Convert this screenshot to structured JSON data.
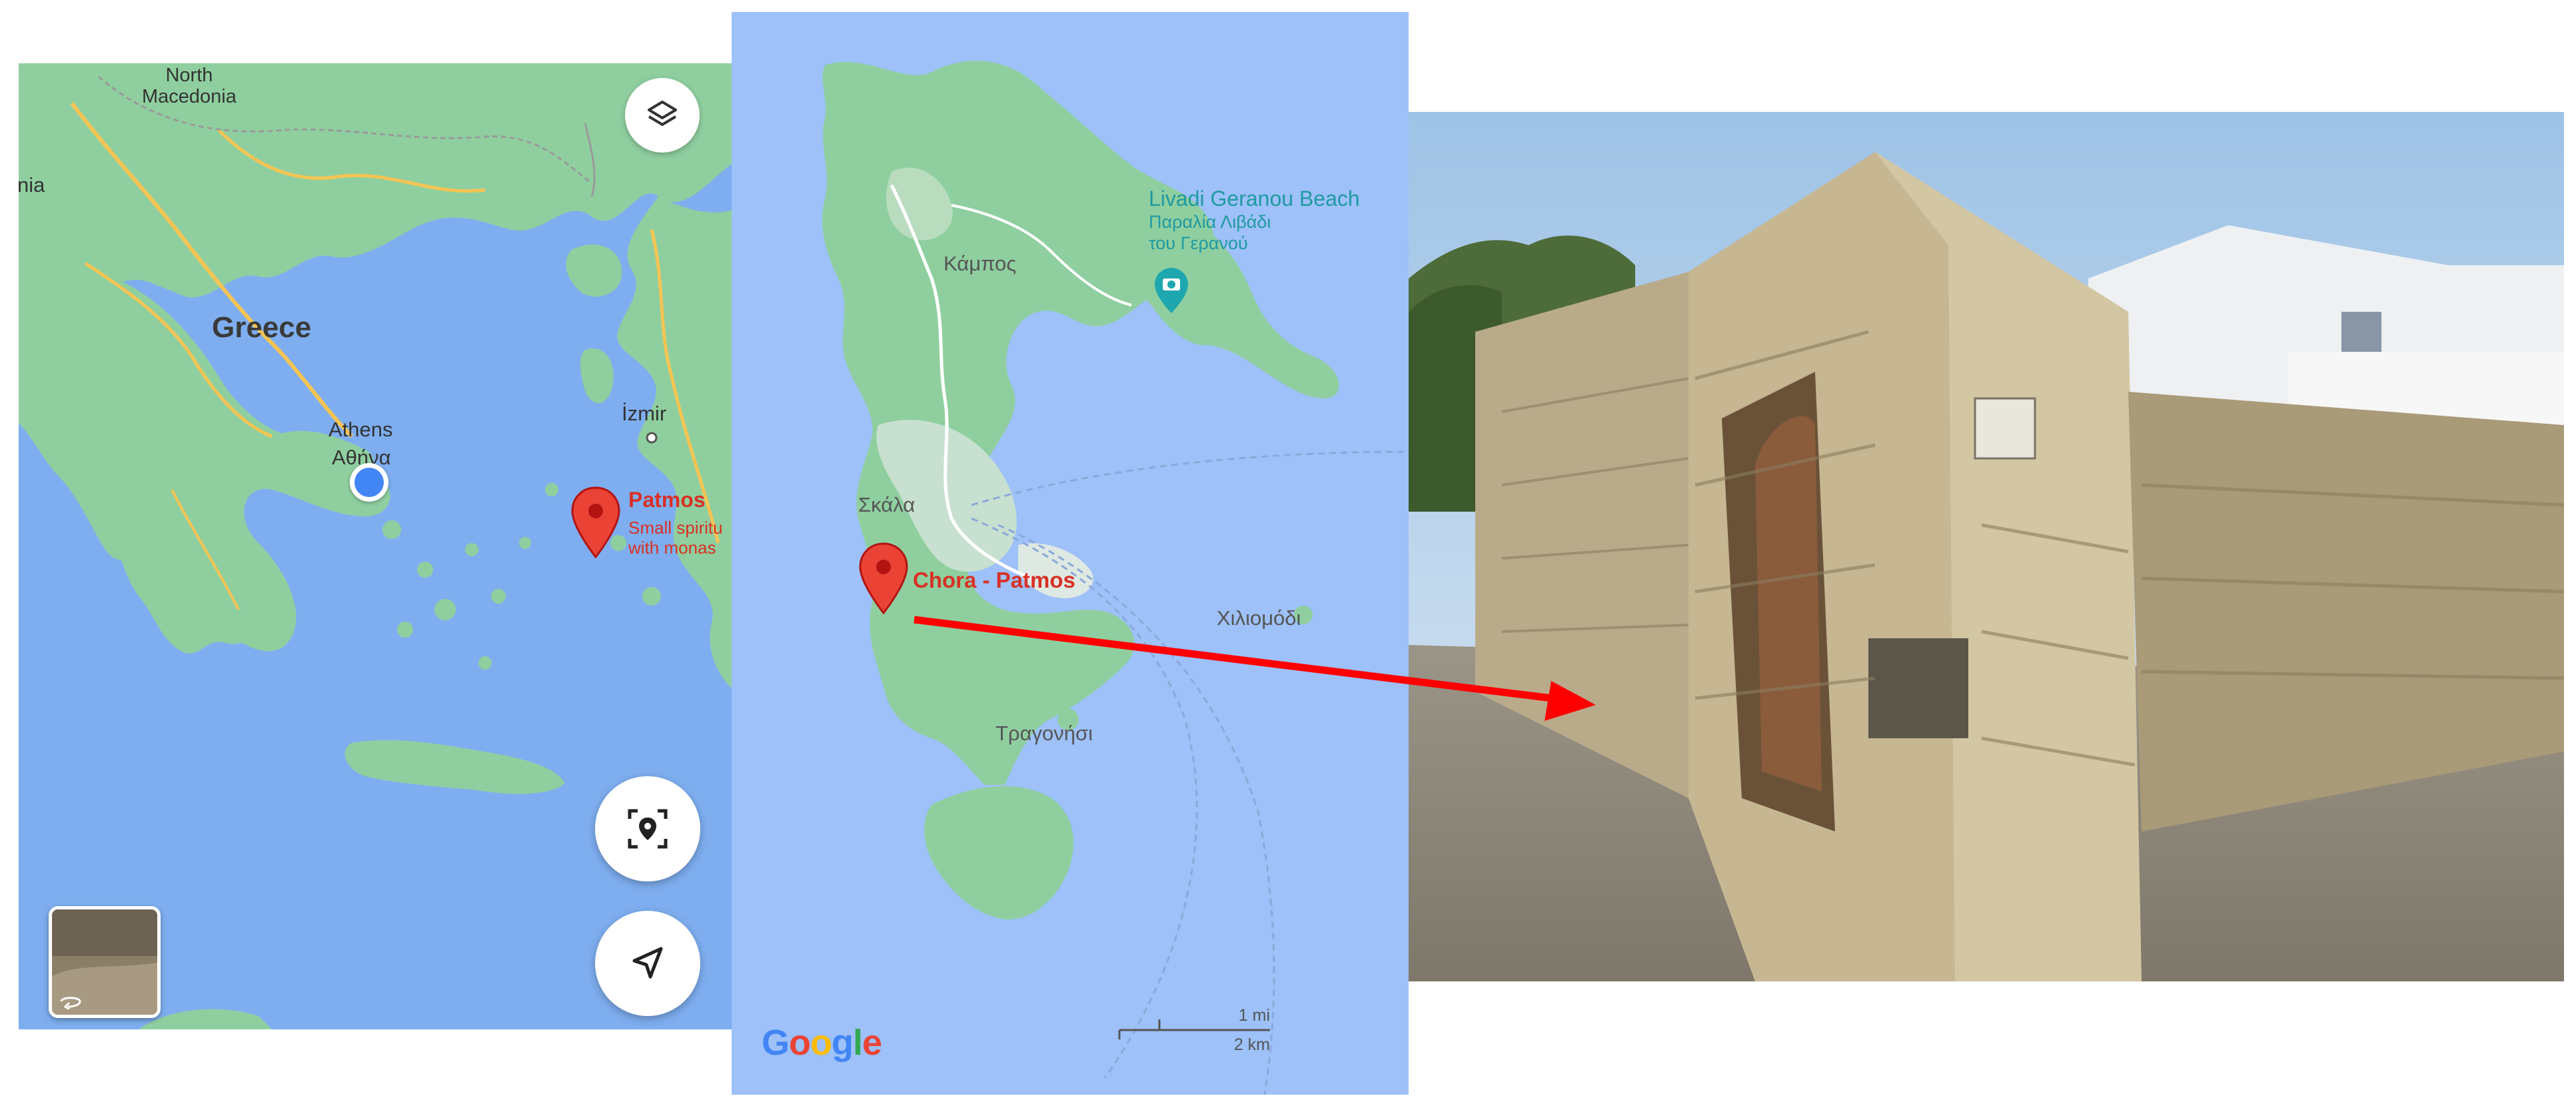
{
  "left_map": {
    "labels": {
      "north_macedonia_line1": "North",
      "north_macedonia_line2": "Macedonia",
      "left_edge": "nia",
      "greece": "Greece",
      "athens": "Athens",
      "athens_greek": "Αθήνα",
      "izmir": "İzmir"
    },
    "pin": {
      "title": "Patmos",
      "subtitle_line1": "Small spiritu",
      "subtitle_line2": "with monas"
    },
    "icons": {
      "layers": "layers-icon",
      "focus_location": "location-focus-icon",
      "navigate": "navigation-arrow-icon",
      "street_view_rotate": "rotate-icon"
    }
  },
  "mid_map": {
    "labels": {
      "kampos": "Κάμπος",
      "beach_name": "Livadi Geranou Beach",
      "beach_greek_line1": "Παραλία Λιβάδι",
      "beach_greek_line2": "του Γερανού",
      "skala": "Σκάλα",
      "chora": "Chora - Patmos",
      "chiliomodi": "Χιλιομόδι",
      "tragonisi": "Τραγονήσι"
    },
    "scale": {
      "imperial": "1 mi",
      "metric": "2 km"
    },
    "logo": {
      "G": "G",
      "o1": "o",
      "o2": "o",
      "g": "g",
      "l": "l",
      "e": "e"
    },
    "logo_colors": [
      "#4285F4",
      "#EA4335",
      "#FBBC05",
      "#4285F4",
      "#34A853",
      "#EA4335"
    ]
  },
  "colors": {
    "water_left": "#7eaef0",
    "water_mid": "#9dc1f8",
    "land": "#8fcf9f",
    "pin": "#ea4335",
    "arrow": "#ff0000",
    "beach_text": "#1f9aa1"
  }
}
